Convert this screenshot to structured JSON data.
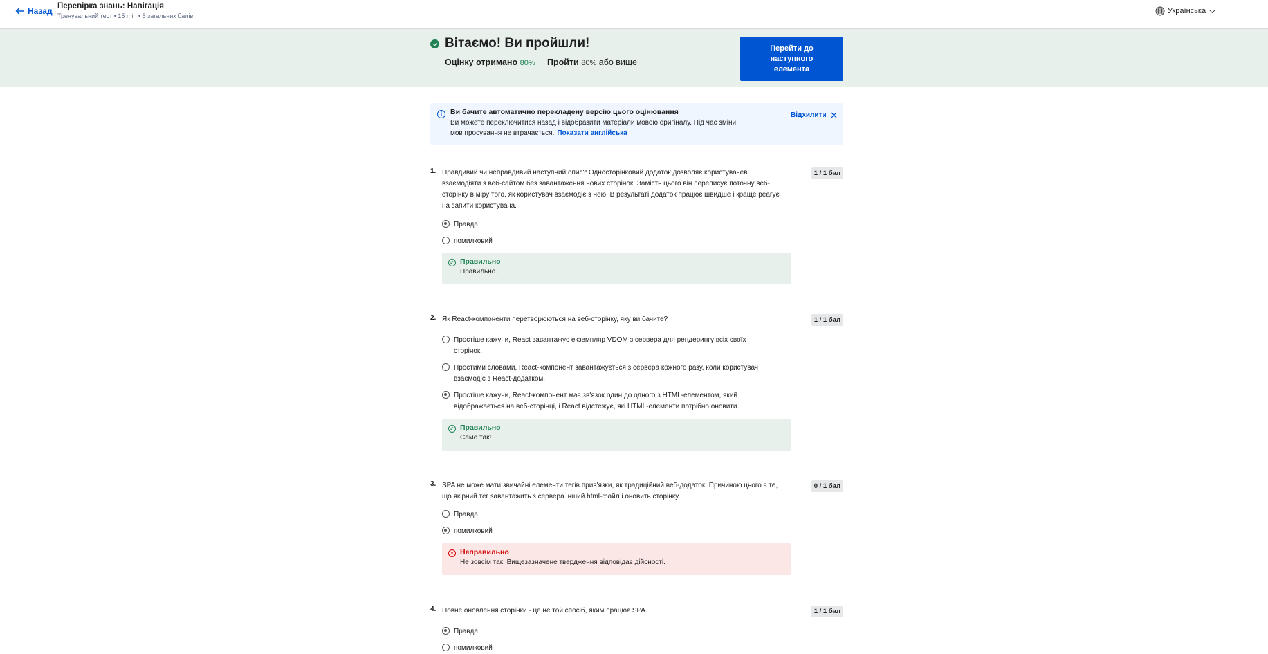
{
  "header": {
    "back_label": "Назад",
    "title": "Перевірка знань: Навігація",
    "subtitle": "Тренувальний тест • 15 min • 5 загальних балів",
    "language": "Українська"
  },
  "banner": {
    "title": "Вітаємо! Ви пройшли!",
    "grade_label": "Оцінку отримано",
    "grade_value": "80%",
    "pass_label": "Пройти",
    "pass_value": "80%",
    "pass_suffix": "або вище",
    "next_button": "Перейти до наступного елемента"
  },
  "notice": {
    "title": "Ви бачите автоматично перекладену версію цього оцінювання",
    "body": "Ви можете переключитися назад і відобразити матеріали мовою оригіналу. Під час зміни мов просування не втрачається.",
    "link": "Показати англійська",
    "dismiss": "Відхилити"
  },
  "questions": [
    {
      "num": "1.",
      "text": "Правдивий чи неправдивий наступний опис? Односторінковий додаток дозволяє користувачеві взаємодіяти з веб-сайтом без завантаження нових сторінок. Замість цього він переписує поточну веб-сторінку в міру того, як користувач взаємодіє з нею. В результаті додаток працює швидше і краще реагує на запити користувача.",
      "score": "1 / 1 бал",
      "options": [
        {
          "label": "Правда",
          "selected": true
        },
        {
          "label": "помилковий",
          "selected": false
        }
      ],
      "feedback": {
        "status": "correct",
        "title": "Правильно",
        "text": "Правильно."
      }
    },
    {
      "num": "2.",
      "text": "Як React-компоненти перетворюються на веб-сторінку, яку ви бачите?",
      "score": "1 / 1 бал",
      "options": [
        {
          "label": "Простіше кажучи, React завантажує екземпляр VDOM з сервера для рендерингу всіх своїх сторінок.",
          "selected": false
        },
        {
          "label": "Простими словами, React-компонент завантажується з сервера кожного разу, коли користувач взаємодіє з React-додатком.",
          "selected": false
        },
        {
          "label": "Простіше кажучи, React-компонент має зв'язок один до одного з HTML-елементом, який відображається на веб-сторінці, і React відстежує, які HTML-елементи потрібно оновити.",
          "selected": true
        }
      ],
      "feedback": {
        "status": "correct",
        "title": "Правильно",
        "text": "Саме так!"
      }
    },
    {
      "num": "3.",
      "text": "SPA не може мати звичайні елементи тегів прив'язки, як традиційний веб-додаток. Причиною цього є те, що якірний тег завантажить з сервера інший html-файл і оновить сторінку.",
      "score": "0 / 1 бал",
      "options": [
        {
          "label": "Правда",
          "selected": false
        },
        {
          "label": "помилковий",
          "selected": true
        }
      ],
      "feedback": {
        "status": "incorrect",
        "title": "Неправильно",
        "text": "Не зовсім так. Вищезазначене твердження відповідає дійсності."
      }
    },
    {
      "num": "4.",
      "text": "Повне оновлення сторінки - це не той спосіб, яким працює SPA.",
      "score": "1 / 1 бал",
      "options": [
        {
          "label": "Правда",
          "selected": true
        },
        {
          "label": "помилковий",
          "selected": false
        }
      ]
    }
  ],
  "colors": {
    "accent": "#0056d2",
    "success": "#1f8354",
    "error": "#d30001",
    "banner_bg": "#e8f0ec",
    "notice_bg": "#f0f6ff"
  }
}
